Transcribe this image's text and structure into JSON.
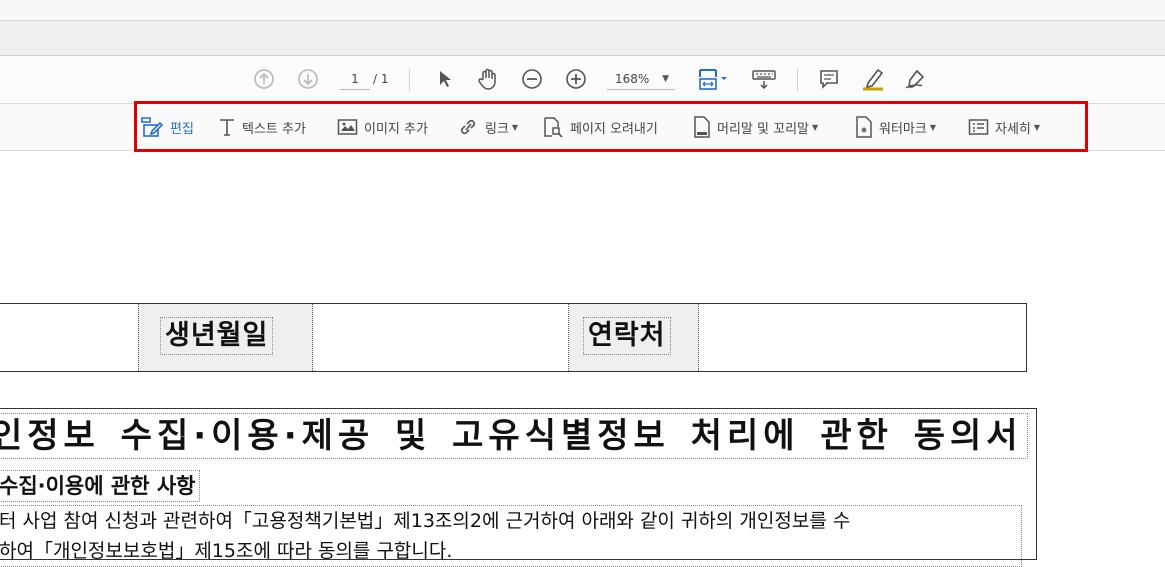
{
  "navigation": {
    "page_current": "1",
    "page_total": "/ 1",
    "zoom": "168%",
    "zoom_caret": "▼"
  },
  "edit_toolbar": {
    "edit": "편집",
    "add_text": "텍스트 추가",
    "add_image": "이미지 추가",
    "link": "링크",
    "crop": "페이지 오려내기",
    "header_footer": "머리말 및 꼬리말",
    "watermark": "워터마크",
    "more": "자세히",
    "dropdown_glyph": "▼"
  },
  "document": {
    "info_fields": [
      "생년월일",
      "연락처"
    ],
    "title": "인정보 수집·이용·제공 및 고유식별정보 처리에 관한 동의서",
    "subtitle": "수집·이용에 관한 사항",
    "body_lines": [
      "터 사업 참여 신청과 관련하여「고용정책기본법」제13조의2에 근거하여 아래와 같이 귀하의 개인정보를 수",
      "하여「개인정보보호법」제15조에 따라 동의를 구합니다."
    ]
  },
  "colors": {
    "accent": "#1f6fd1",
    "highlight_border": "#e00000",
    "disabled_icon": "#b8b8b8"
  }
}
